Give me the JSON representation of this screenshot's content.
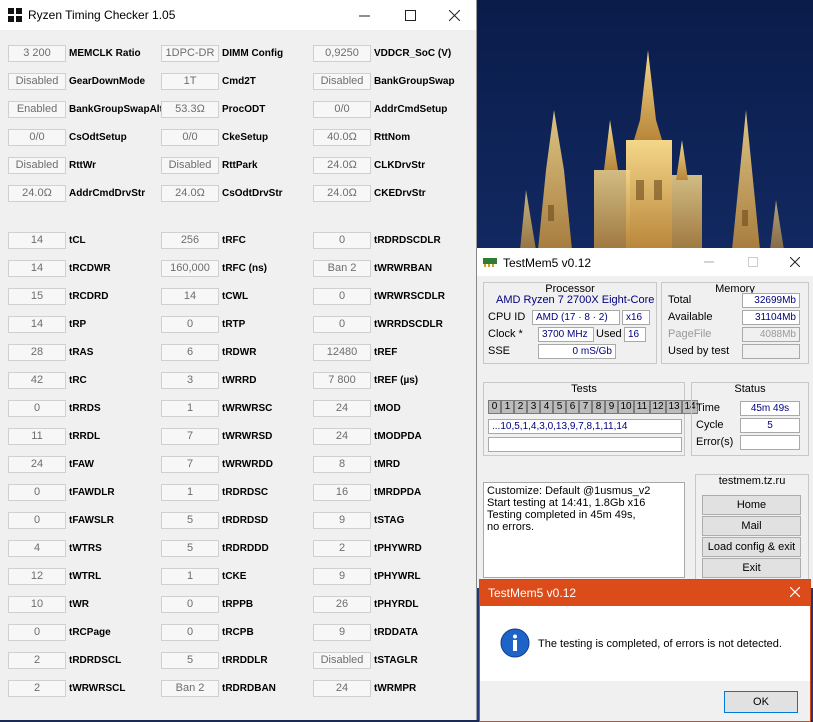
{
  "rtc": {
    "title": "Ryzen Timing Checker 1.05",
    "rows": [
      [
        {
          "v": "3 200",
          "l": "MEMCLK Ratio"
        },
        {
          "v": "1DPC-DR",
          "l": "DIMM Config"
        },
        {
          "v": "0,9250",
          "l": "VDDCR_SoC (V)"
        }
      ],
      [
        {
          "v": "Disabled",
          "l": "GearDownMode"
        },
        {
          "v": "1T",
          "l": "Cmd2T"
        },
        {
          "v": "Disabled",
          "l": "BankGroupSwap"
        }
      ],
      [
        {
          "v": "Enabled",
          "l": "BankGroupSwapAlt"
        },
        {
          "v": "53.3Ω",
          "l": "ProcODT"
        },
        {
          "v": "0/0",
          "l": "AddrCmdSetup"
        }
      ],
      [
        {
          "v": "0/0",
          "l": "CsOdtSetup"
        },
        {
          "v": "0/0",
          "l": "CkeSetup"
        },
        {
          "v": "40.0Ω",
          "l": "RttNom"
        }
      ],
      [
        {
          "v": "Disabled",
          "l": "RttWr"
        },
        {
          "v": "Disabled",
          "l": "RttPark"
        },
        {
          "v": "24.0Ω",
          "l": "CLKDrvStr"
        }
      ],
      [
        {
          "v": "24.0Ω",
          "l": "AddrCmdDrvStr"
        },
        {
          "v": "24.0Ω",
          "l": "CsOdtDrvStr"
        },
        {
          "v": "24.0Ω",
          "l": "CKEDrvStr"
        }
      ],
      [
        {
          "v": "14",
          "l": "tCL"
        },
        {
          "v": "256",
          "l": "tRFC"
        },
        {
          "v": "0",
          "l": "tRDRDSCDLR"
        }
      ],
      [
        {
          "v": "14",
          "l": "tRCDWR"
        },
        {
          "v": "160,000",
          "l": "tRFC (ns)"
        },
        {
          "v": "Ban 2",
          "l": "tWRWRBAN"
        }
      ],
      [
        {
          "v": "15",
          "l": "tRCDRD"
        },
        {
          "v": "14",
          "l": "tCWL"
        },
        {
          "v": "0",
          "l": "tWRWRSCDLR"
        }
      ],
      [
        {
          "v": "14",
          "l": "tRP"
        },
        {
          "v": "0",
          "l": "tRTP"
        },
        {
          "v": "0",
          "l": "tWRRDSCDLR"
        }
      ],
      [
        {
          "v": "28",
          "l": "tRAS"
        },
        {
          "v": "6",
          "l": "tRDWR"
        },
        {
          "v": "12480",
          "l": "tREF"
        }
      ],
      [
        {
          "v": "42",
          "l": "tRC"
        },
        {
          "v": "3",
          "l": "tWRRD"
        },
        {
          "v": "7 800",
          "l": "tREF (µs)"
        }
      ],
      [
        {
          "v": "0",
          "l": "tRRDS"
        },
        {
          "v": "1",
          "l": "tWRWRSC"
        },
        {
          "v": "24",
          "l": "tMOD"
        }
      ],
      [
        {
          "v": "11",
          "l": "tRRDL"
        },
        {
          "v": "7",
          "l": "tWRWRSD"
        },
        {
          "v": "24",
          "l": "tMODPDA"
        }
      ],
      [
        {
          "v": "24",
          "l": "tFAW"
        },
        {
          "v": "7",
          "l": "tWRWRDD"
        },
        {
          "v": "8",
          "l": "tMRD"
        }
      ],
      [
        {
          "v": "0",
          "l": "tFAWDLR"
        },
        {
          "v": "1",
          "l": "tRDRDSC"
        },
        {
          "v": "16",
          "l": "tMRDPDA"
        }
      ],
      [
        {
          "v": "0",
          "l": "tFAWSLR"
        },
        {
          "v": "5",
          "l": "tRDRDSD"
        },
        {
          "v": "9",
          "l": "tSTAG"
        }
      ],
      [
        {
          "v": "4",
          "l": "tWTRS"
        },
        {
          "v": "5",
          "l": "tRDRDDD"
        },
        {
          "v": "2",
          "l": "tPHYWRD"
        }
      ],
      [
        {
          "v": "12",
          "l": "tWTRL"
        },
        {
          "v": "1",
          "l": "tCKE"
        },
        {
          "v": "9",
          "l": "tPHYWRL"
        }
      ],
      [
        {
          "v": "10",
          "l": "tWR"
        },
        {
          "v": "0",
          "l": "tRPPB"
        },
        {
          "v": "26",
          "l": "tPHYRDL"
        }
      ],
      [
        {
          "v": "0",
          "l": "tRCPage"
        },
        {
          "v": "0",
          "l": "tRCPB"
        },
        {
          "v": "9",
          "l": "tRDDATA"
        }
      ],
      [
        {
          "v": "2",
          "l": "tRDRDSCL"
        },
        {
          "v": "5",
          "l": "tRRDDLR"
        },
        {
          "v": "Disabled",
          "l": "tSTAGLR"
        }
      ],
      [
        {
          "v": "2",
          "l": "tWRWRSCL"
        },
        {
          "v": "Ban 2",
          "l": "tRDRDBAN"
        },
        {
          "v": "24",
          "l": "tWRMPR"
        }
      ]
    ]
  },
  "tm5": {
    "title": "TestMem5 v0.12",
    "processor": {
      "heading": "Processor",
      "name": "AMD Ryzen 7 2700X Eight-Core",
      "cpu_id_label": "CPU ID",
      "cpu_id": "AMD  (17 · 8 · 2)",
      "threads": "x16",
      "clock_label": "Clock *",
      "clock": "3700 MHz",
      "used_label": "Used",
      "used": "16",
      "sse_label": "SSE",
      "sse": "0 mS/Gb"
    },
    "memory": {
      "heading": "Memory",
      "total_label": "Total",
      "total": "32699Mb",
      "available_label": "Available",
      "available": "31104Mb",
      "pagefile_label": "PageFile",
      "pagefile": "4088Mb",
      "usedbytest_label": "Used by test",
      "usedbytest": ""
    },
    "tests": {
      "heading": "Tests",
      "cells": [
        "0",
        "1",
        "2",
        "3",
        "4",
        "5",
        "6",
        "7",
        "8",
        "9",
        "10",
        "11",
        "12",
        "13",
        "14"
      ],
      "sequence": "...10,5,1,4,3,0,13,9,7,8,1,11,14"
    },
    "status": {
      "heading": "Status",
      "time_label": "Time",
      "time": "45m 49s",
      "cycle_label": "Cycle",
      "cycle": "5",
      "errors_label": "Error(s)",
      "errors": ""
    },
    "log": [
      "Customize: Default @1usmus_v2",
      "Start testing at 14:41, 1.8Gb x16",
      "Testing completed in 45m 49s,",
      "no errors."
    ],
    "site": "testmem.tz.ru",
    "buttons": {
      "home": "Home",
      "mail": "Mail",
      "load": "Load config & exit",
      "exit": "Exit"
    }
  },
  "dialog": {
    "title": "TestMem5 v0.12",
    "message": "The testing is completed, of errors is not detected.",
    "ok": "OK"
  },
  "colors": {
    "dialog_accent": "#dc4c1a",
    "value_text": "#000080"
  }
}
